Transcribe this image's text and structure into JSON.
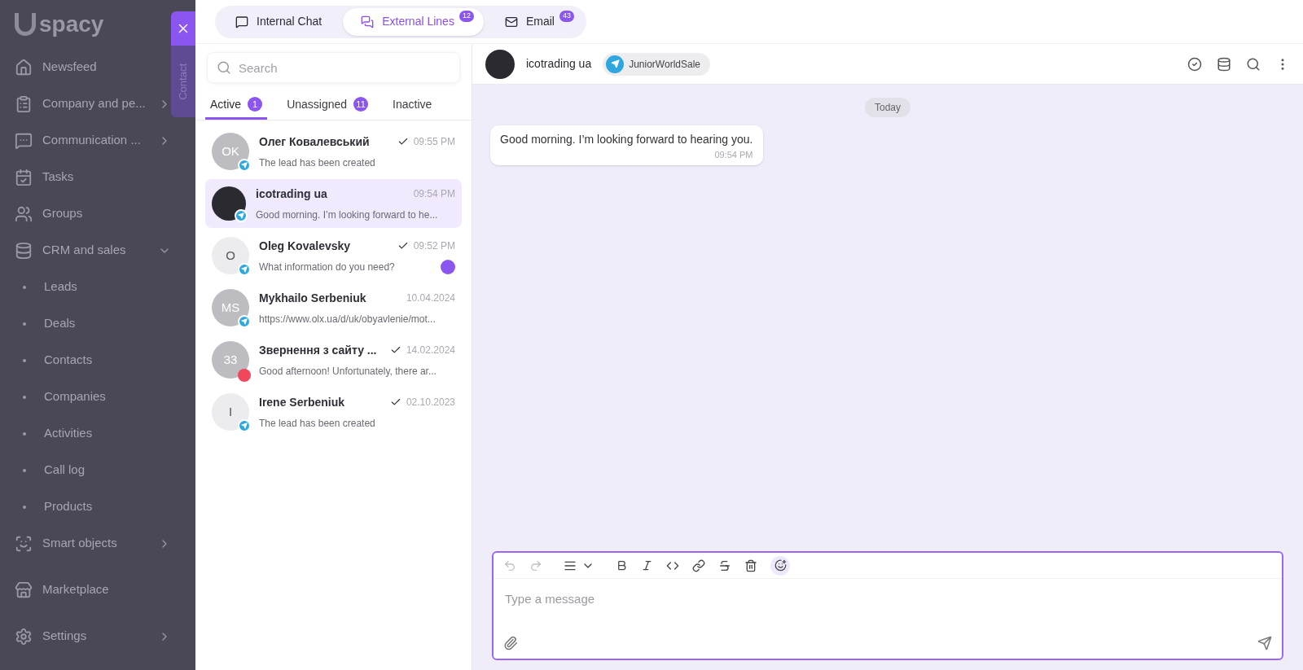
{
  "sidebar": {
    "logo": "spacy",
    "items": [
      {
        "label": "Newsfeed",
        "kind": "link"
      },
      {
        "label": "Company and pe...",
        "kind": "group",
        "expanded": false
      },
      {
        "label": "Communication ...",
        "kind": "group",
        "expanded": false
      },
      {
        "label": "Tasks",
        "kind": "link"
      },
      {
        "label": "Groups",
        "kind": "link"
      },
      {
        "label": "CRM and sales",
        "kind": "group",
        "expanded": true,
        "children": [
          {
            "label": "Leads"
          },
          {
            "label": "Deals"
          },
          {
            "label": "Contacts"
          },
          {
            "label": "Companies"
          },
          {
            "label": "Activities"
          },
          {
            "label": "Call log"
          },
          {
            "label": "Products"
          }
        ]
      },
      {
        "label": "Smart objects",
        "kind": "group",
        "expanded": false
      },
      {
        "label": "Marketplace",
        "kind": "link"
      },
      {
        "label": "Settings",
        "kind": "group",
        "expanded": false
      }
    ]
  },
  "drawer_tab": {
    "label": "Contact"
  },
  "top_tabs": [
    {
      "label": "Internal Chat",
      "selected": false
    },
    {
      "label": "External Lines",
      "selected": true,
      "badge": "12"
    },
    {
      "label": "Email",
      "selected": false,
      "badge": "43"
    }
  ],
  "search": {
    "placeholder": "Search"
  },
  "list_tabs": [
    {
      "label": "Active",
      "selected": true,
      "count": "1"
    },
    {
      "label": "Unassigned",
      "selected": false,
      "count": "11"
    },
    {
      "label": "Inactive",
      "selected": false
    }
  ],
  "conversations": [
    {
      "name": "Олег Ковалевський",
      "avatar": {
        "kind": "initials",
        "text": "OK",
        "color": "#bdbcc0"
      },
      "read": true,
      "time": "09:55 PM",
      "preview": "The lead has been created",
      "selected": false,
      "unread": false
    },
    {
      "name": "icotrading ua",
      "avatar": {
        "kind": "photo"
      },
      "read": false,
      "time": "09:54 PM",
      "preview": "Good morning. I’m looking forward to he...",
      "selected": true,
      "unread": false
    },
    {
      "name": "Oleg Kovalevsky",
      "avatar": {
        "kind": "initials",
        "text": "O",
        "color": "#ececef"
      },
      "read": true,
      "time": "09:52 PM",
      "preview": "What information do you need?",
      "selected": false,
      "unread": true
    },
    {
      "name": "Mykhailo Serbeniuk",
      "avatar": {
        "kind": "initials",
        "text": "MS",
        "color": "#bdbcc0"
      },
      "read": false,
      "time": "10.04.2024",
      "preview": "https://www.olx.ua/d/uk/obyavlenie/mot...",
      "selected": false,
      "unread": false
    },
    {
      "name": "Звернення з сайту ...",
      "avatar": {
        "kind": "initials",
        "text": "33",
        "color": "#bdbcc0",
        "badge": {
          "kind": "dot",
          "color": "#f0475c"
        }
      },
      "read": true,
      "time": "14.02.2024",
      "preview": "Good afternoon! Unfortunately, there ar...",
      "selected": false,
      "unread": false
    },
    {
      "name": "Irene Serbeniuk",
      "avatar": {
        "kind": "initials",
        "text": "I",
        "color": "#ececef"
      },
      "read": true,
      "time": "02.10.2023",
      "preview": "The lead has been created",
      "selected": false,
      "unread": false
    }
  ],
  "chat": {
    "name": "icotrading ua",
    "channel": "JuniorWorldSale",
    "date": "Today",
    "messages": [
      {
        "text": "Good morning. I’m looking forward to hearing you.",
        "time": "09:54 PM"
      }
    ],
    "composer": {
      "placeholder": "Type a message"
    }
  }
}
